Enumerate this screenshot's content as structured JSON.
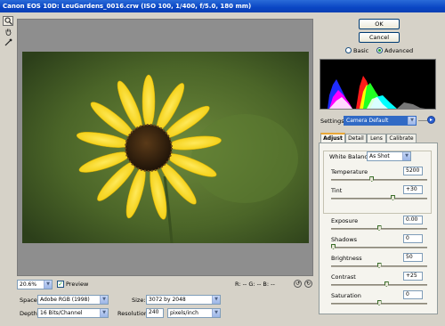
{
  "window": {
    "title": "Canon EOS 10D:  LeuGardens_0016.crw  (ISO 100, 1/400, f/5.0, 180 mm)"
  },
  "tools": [
    {
      "name": "zoom-icon",
      "glyph": "🔍"
    },
    {
      "name": "hand-icon",
      "glyph": "✋"
    },
    {
      "name": "eyedropper-icon",
      "glyph": "✎"
    }
  ],
  "status": {
    "zoom": "20.6%",
    "preview_label": "Preview",
    "preview_checked": true,
    "r": "R:  -- G:  -- B:  --"
  },
  "bottom": {
    "space_label": "Space:",
    "space_value": "Adobe RGB (1998)",
    "depth_label": "Depth:",
    "depth_value": "16 Bits/Channel",
    "size_label": "Size:",
    "size_value": "3072 by 2048",
    "resolution_label": "Resolution:",
    "resolution_value": "240",
    "resolution_unit": "pixels/inch"
  },
  "buttons": {
    "ok": "OK",
    "cancel": "Cancel"
  },
  "mode": {
    "basic": "Basic",
    "advanced": "Advanced",
    "selected": "advanced"
  },
  "settings": {
    "label": "Settings:",
    "value": "Camera Default"
  },
  "tabs": [
    "Adjust",
    "Detail",
    "Lens",
    "Calibrate"
  ],
  "active_tab": "Adjust",
  "white_balance": {
    "label": "White Balance:",
    "value": "As Shot"
  },
  "adjust": [
    {
      "key": "temperature",
      "label": "Temperature",
      "value": "5200",
      "level": 0.42
    },
    {
      "key": "tint",
      "label": "Tint",
      "value": "+30",
      "level": 0.65
    },
    {
      "key": "exposure",
      "label": "Exposure",
      "value": "0.00",
      "level": 0.5
    },
    {
      "key": "shadows",
      "label": "Shadows",
      "value": "0",
      "level": 0.0
    },
    {
      "key": "brightness",
      "label": "Brightness",
      "value": "50",
      "level": 0.5
    },
    {
      "key": "contrast",
      "label": "Contrast",
      "value": "+25",
      "level": 0.58
    },
    {
      "key": "saturation",
      "label": "Saturation",
      "value": "0",
      "level": 0.5
    }
  ],
  "colors": {
    "accent": "#0a46c4",
    "tab_highlight": "#e9a737",
    "check": "#21a121"
  }
}
